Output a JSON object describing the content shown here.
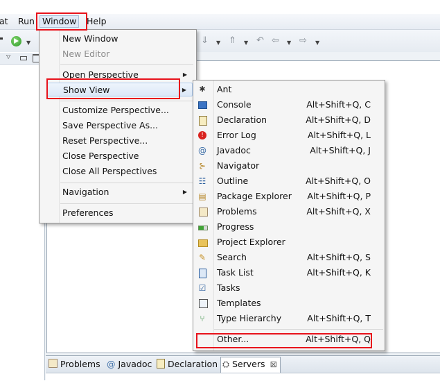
{
  "menubar": {
    "items": [
      {
        "label": "at"
      },
      {
        "label": "Run"
      },
      {
        "label": "Window"
      },
      {
        "label": "Help"
      }
    ]
  },
  "window_menu": {
    "items": [
      {
        "label": "New Window"
      },
      {
        "label": "New Editor"
      },
      {
        "label": "Open Perspective"
      },
      {
        "label": "Show View"
      },
      {
        "label": "Customize Perspective..."
      },
      {
        "label": "Save Perspective As..."
      },
      {
        "label": "Reset Perspective..."
      },
      {
        "label": "Close Perspective"
      },
      {
        "label": "Close All Perspectives"
      },
      {
        "label": "Navigation"
      },
      {
        "label": "Preferences"
      }
    ]
  },
  "show_view_menu": {
    "items": [
      {
        "label": "Ant",
        "shortcut": "",
        "icon": "ant-icon"
      },
      {
        "label": "Console",
        "shortcut": "Alt+Shift+Q, C",
        "icon": "console-icon"
      },
      {
        "label": "Declaration",
        "shortcut": "Alt+Shift+Q, D",
        "icon": "declaration-icon"
      },
      {
        "label": "Error Log",
        "shortcut": "Alt+Shift+Q, L",
        "icon": "error-log-icon"
      },
      {
        "label": "Javadoc",
        "shortcut": "Alt+Shift+Q, J",
        "icon": "javadoc-icon"
      },
      {
        "label": "Navigator",
        "shortcut": "",
        "icon": "navigator-icon"
      },
      {
        "label": "Outline",
        "shortcut": "Alt+Shift+Q, O",
        "icon": "outline-icon"
      },
      {
        "label": "Package Explorer",
        "shortcut": "Alt+Shift+Q, P",
        "icon": "package-explorer-icon"
      },
      {
        "label": "Problems",
        "shortcut": "Alt+Shift+Q, X",
        "icon": "problems-icon"
      },
      {
        "label": "Progress",
        "shortcut": "",
        "icon": "progress-icon"
      },
      {
        "label": "Project Explorer",
        "shortcut": "",
        "icon": "project-explorer-icon"
      },
      {
        "label": "Search",
        "shortcut": "Alt+Shift+Q, S",
        "icon": "search-icon"
      },
      {
        "label": "Task List",
        "shortcut": "Alt+Shift+Q, K",
        "icon": "task-list-icon"
      },
      {
        "label": "Tasks",
        "shortcut": "",
        "icon": "tasks-icon"
      },
      {
        "label": "Templates",
        "shortcut": "",
        "icon": "templates-icon"
      },
      {
        "label": "Type Hierarchy",
        "shortcut": "Alt+Shift+Q, T",
        "icon": "type-hierarchy-icon"
      },
      {
        "label": "Other...",
        "shortcut": "Alt+Shift+Q, Q",
        "icon": ""
      }
    ]
  },
  "bottom_tabs": {
    "items": [
      {
        "label": "Problems",
        "icon": "problems-icon"
      },
      {
        "label": "Javadoc",
        "icon": "javadoc-icon"
      },
      {
        "label": "Declaration",
        "icon": "declaration-icon"
      },
      {
        "label": "Servers",
        "icon": "servers-icon"
      }
    ],
    "close_glyph": "⊠"
  },
  "colors": {
    "highlight_box": "#e8121b",
    "menu_hover": "#dce8f7"
  }
}
